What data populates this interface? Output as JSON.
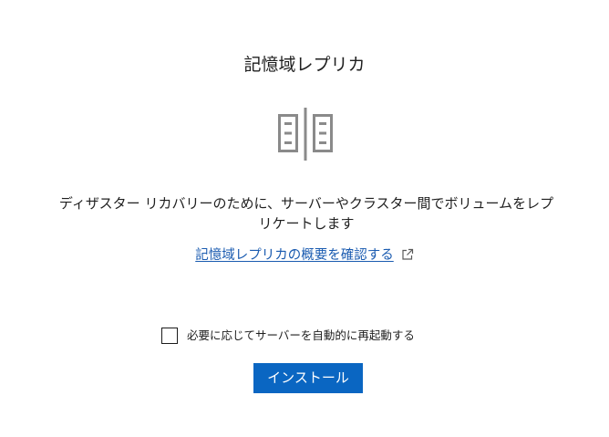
{
  "title": "記憶域レプリカ",
  "hero_icon": "storage-replica-icon",
  "description": "ディザスター リカバリーのために、サーバーやクラスター間でボリュームをレプリケートします",
  "overview_link": {
    "label": "記憶域レプリカの概要を確認する",
    "icon": "external-link-icon"
  },
  "restart_option": {
    "label": "必要に応じてサーバーを自動的に再起動する",
    "checked": false
  },
  "install_button": {
    "label": "インストール"
  },
  "colors": {
    "accent": "#0a66c2",
    "link": "#1a5bb0",
    "icon_gray": "#8a8a8a",
    "text": "#1f1f1f"
  }
}
